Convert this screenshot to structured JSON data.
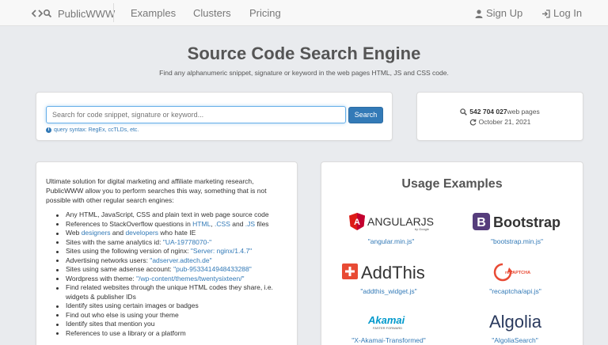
{
  "nav": {
    "brand": "PublicWWW",
    "links": [
      "Examples",
      "Clusters",
      "Pricing"
    ],
    "signup": "Sign Up",
    "login": "Log In"
  },
  "hero": {
    "title": "Source Code Search Engine",
    "subtitle": "Find any alphanumeric snippet, signature or keyword in the web pages HTML, JS and CSS code."
  },
  "search": {
    "placeholder": "Search for code snippet, signature or keyword...",
    "button": "Search",
    "hint": "query syntax: RegEx, ccTLDs, etc."
  },
  "stats": {
    "count": "542 704 027",
    "count_suffix": " web pages",
    "date": "October 21, 2021"
  },
  "about": {
    "intro": "Ultimate solution for digital marketing and affiliate marketing research, PublicWWW allow you to perform searches this way, something that is not possible with other regular search engines:",
    "f1": "Any HTML, JavaScript, CSS and plain text in web page source code",
    "f2_pre": "References to StackOverflow questions in ",
    "f2_l1": "HTML",
    "f2_sep1": ", ",
    "f2_l2": ".CSS",
    "f2_sep2": " and ",
    "f2_l3": ".JS",
    "f2_post": " files",
    "f3_pre": "Web ",
    "f3_l1": "designers",
    "f3_mid": " and ",
    "f3_l2": "developers",
    "f3_post": " who hate IE",
    "f4_pre": "Sites with the same analytics id: ",
    "f4_link": "\"UA-19778070-\"",
    "f5_pre": "Sites using the following version of nginx: ",
    "f5_link": "\"Server: nginx/1.4.7\"",
    "f6_pre": "Advertising networks users: ",
    "f6_link": "\"adserver.adtech.de\"",
    "f7_pre": "Sites using same adsense account: ",
    "f7_link": "\"pub-9533414948433288\"",
    "f8_pre": "Wordpress with theme: ",
    "f8_link": "\"/wp-content/themes/twentysixteen/\"",
    "f9": "Find related websites through the unique HTML codes they share, i.e. widgets & publisher IDs",
    "f10": "Identify sites using certain images or badges",
    "f11": "Find out who else is using your theme",
    "f12": "Identify sites that mention you",
    "f13": "References to use a library or a platform"
  },
  "usage": {
    "title": "Usage Examples",
    "examples": [
      {
        "logo": "ANGULARJS",
        "logo_sub": "by Google",
        "caption": "\"angular.min.js\""
      },
      {
        "logo": "Bootstrap",
        "caption": "\"bootstrap.min.js\""
      },
      {
        "logo": "AddThis",
        "caption": "\"addthis_widget.js\""
      },
      {
        "logo": "reCAPTCHA",
        "caption": "\"recaptcha/api.js\""
      },
      {
        "logo": "Akamai",
        "logo_sub": "FASTER FORWARD",
        "caption": "\"X-Akamai-Transformed\""
      },
      {
        "logo": "Algolia",
        "caption": "\"AlgoliaSearch\""
      }
    ]
  },
  "colors": {
    "link": "#337ab7",
    "angular": "#dd1b16",
    "bootstrap": "#563d7c",
    "addthis": "#e84a34",
    "akamai": "#0099cc",
    "algolia": "#2a3a5e"
  }
}
